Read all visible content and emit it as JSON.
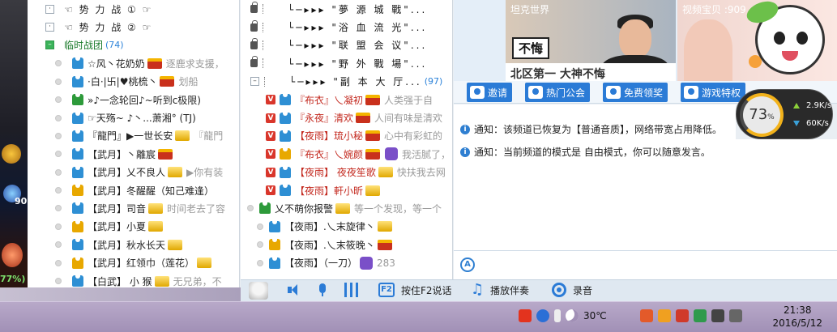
{
  "left_panel": {
    "groups_top": [
      {
        "name": "☜ 势 力 战 ① ☞",
        "expanded": false
      },
      {
        "name": "☜ 势 力 战 ② ☞",
        "expanded": false
      }
    ],
    "temp_group": {
      "name": "临时战团",
      "count": "(74)"
    },
    "members": [
      {
        "name": "☆风丶花奶奶",
        "sig": "逐鹿求支援，",
        "shirt": "#2e8fd4",
        "crown": "red"
      },
      {
        "name": "·白·|卐|♥桃梳丶",
        "sig": "划船",
        "shirt": "#2e8fd4",
        "crown": "red"
      },
      {
        "name": "»♪一念轮回♪~听到c极限)",
        "sig": "",
        "shirt": "#2d9a3a",
        "crown": ""
      },
      {
        "name": "☞天殇~ ♪丶...萧湘° (TJ)",
        "sig": "",
        "shirt": "#2e8fd4",
        "crown": ""
      },
      {
        "name": "『龍門』▶一世长安",
        "sig": "『龍門",
        "shirt": "#2e8fd4",
        "crown": "gold"
      },
      {
        "name": "【武月】丶離宸",
        "sig": "",
        "shirt": "#2e8fd4",
        "crown": "red"
      },
      {
        "name": "【武月】乂不良人",
        "sig": "▶你有装",
        "shirt": "#2e8fd4",
        "crown": "gold"
      },
      {
        "name": "【武月】冬醒醒（知己难逢）",
        "sig": "",
        "shirt": "#e8a800",
        "crown": ""
      },
      {
        "name": "【武月】司音",
        "sig": "时间老去了容",
        "shirt": "#2e8fd4",
        "crown": "gold"
      },
      {
        "name": "【武月】小夏",
        "sig": "",
        "shirt": "#e8a800",
        "crown": "gold"
      },
      {
        "name": "【武月】秋水长天",
        "sig": "",
        "shirt": "#2e8fd4",
        "crown": "gold"
      },
      {
        "name": "【武月】红领巾（莲花）",
        "sig": "",
        "shirt": "#e8a800",
        "crown": "gold"
      },
      {
        "name": "【白武】 小 猴",
        "sig": "无兄弟，不",
        "shirt": "#2e8fd4",
        "crown": "gold"
      }
    ]
  },
  "mid_panel": {
    "channels": [
      {
        "name": "└─▸▸▸ \"夢 源 城 戰\"...",
        "expanded": false
      },
      {
        "name": "└─▸▸▸ \"浴 血 流 光\"...",
        "expanded": false
      },
      {
        "name": "└─▸▸▸ \"联 盟 会 议\"...",
        "expanded": false
      },
      {
        "name": "└─▸▸▸ \"野 外 戰 場\"...",
        "expanded": false
      },
      {
        "name": "└─▸▸▸ \"副 本 大 厅...",
        "expanded": true,
        "count": "(97)"
      }
    ],
    "members": [
      {
        "name": "『布衣』乀凝初",
        "sig": "人类强于自",
        "shirt": "#2e8fd4",
        "crown": "red",
        "v": true
      },
      {
        "name": "『永夜』清欢",
        "sig": "人间有味是清欢",
        "shirt": "#2e8fd4",
        "crown": "red",
        "v": true
      },
      {
        "name": "【夜雨】琉小秘",
        "sig": "心中有彩虹的",
        "shirt": "#2e8fd4",
        "crown": "red",
        "v": true
      },
      {
        "name": "『布衣』乀婉颜",
        "sig": "我活腻了，",
        "shirt": "#e8a800",
        "crown": "red",
        "v": true
      },
      {
        "name": "【夜雨】 夜夜笙歌",
        "sig": "快扶我去网",
        "shirt": "#2e8fd4",
        "crown": "gold",
        "v": true
      },
      {
        "name": "【夜雨】軒小昕",
        "sig": "",
        "shirt": "#2e8fd4",
        "crown": "gold",
        "v": true
      },
      {
        "name": "乂不萌你报警",
        "sig": "等一个发现，等一个",
        "shirt": "#2d9a3a",
        "crown": "gold",
        "v": false
      },
      {
        "name": "【夜雨】.乀末旋律丶",
        "sig": "",
        "shirt": "#2e8fd4",
        "crown": "gold",
        "v": false
      },
      {
        "name": "【夜雨】.乀末筱晚丶",
        "sig": "",
        "shirt": "#e8a800",
        "crown": "red",
        "v": false
      },
      {
        "name": "【夜雨】（一刀）",
        "sig": "283",
        "shirt": "#2e8fd4",
        "crown": "",
        "v": false
      }
    ]
  },
  "ads": {
    "ad1_title": "坦克世界",
    "ad1_badge": "不悔",
    "ad1_caption": "北区第一 大神不悔",
    "ad2_title": "视频宝贝 :909"
  },
  "toolbar": {
    "invite": "邀请",
    "hot_guild": "热门公会",
    "free_gift": "免费领奖",
    "game_privilege": "游戏特权"
  },
  "gauge": {
    "percent": "73",
    "percent_unit": "%",
    "upload": "2.9K/s",
    "download": "60K/s"
  },
  "notices": [
    "通知：该频道已恢复为【普通音质】，网络带宽占用降低。",
    "通知：当前频道的模式是 自由模式，你可以随意发言。"
  ],
  "bottom_bar": {
    "press_f2": "按住F2说话",
    "play_accompany": "播放伴奏",
    "record": "录音",
    "f2_key": "F2"
  },
  "taskbar": {
    "temperature": "30℃",
    "time": "21:38",
    "date": "2016/5/12"
  },
  "left_strip": {
    "num": "90",
    "pct": "77%)"
  }
}
